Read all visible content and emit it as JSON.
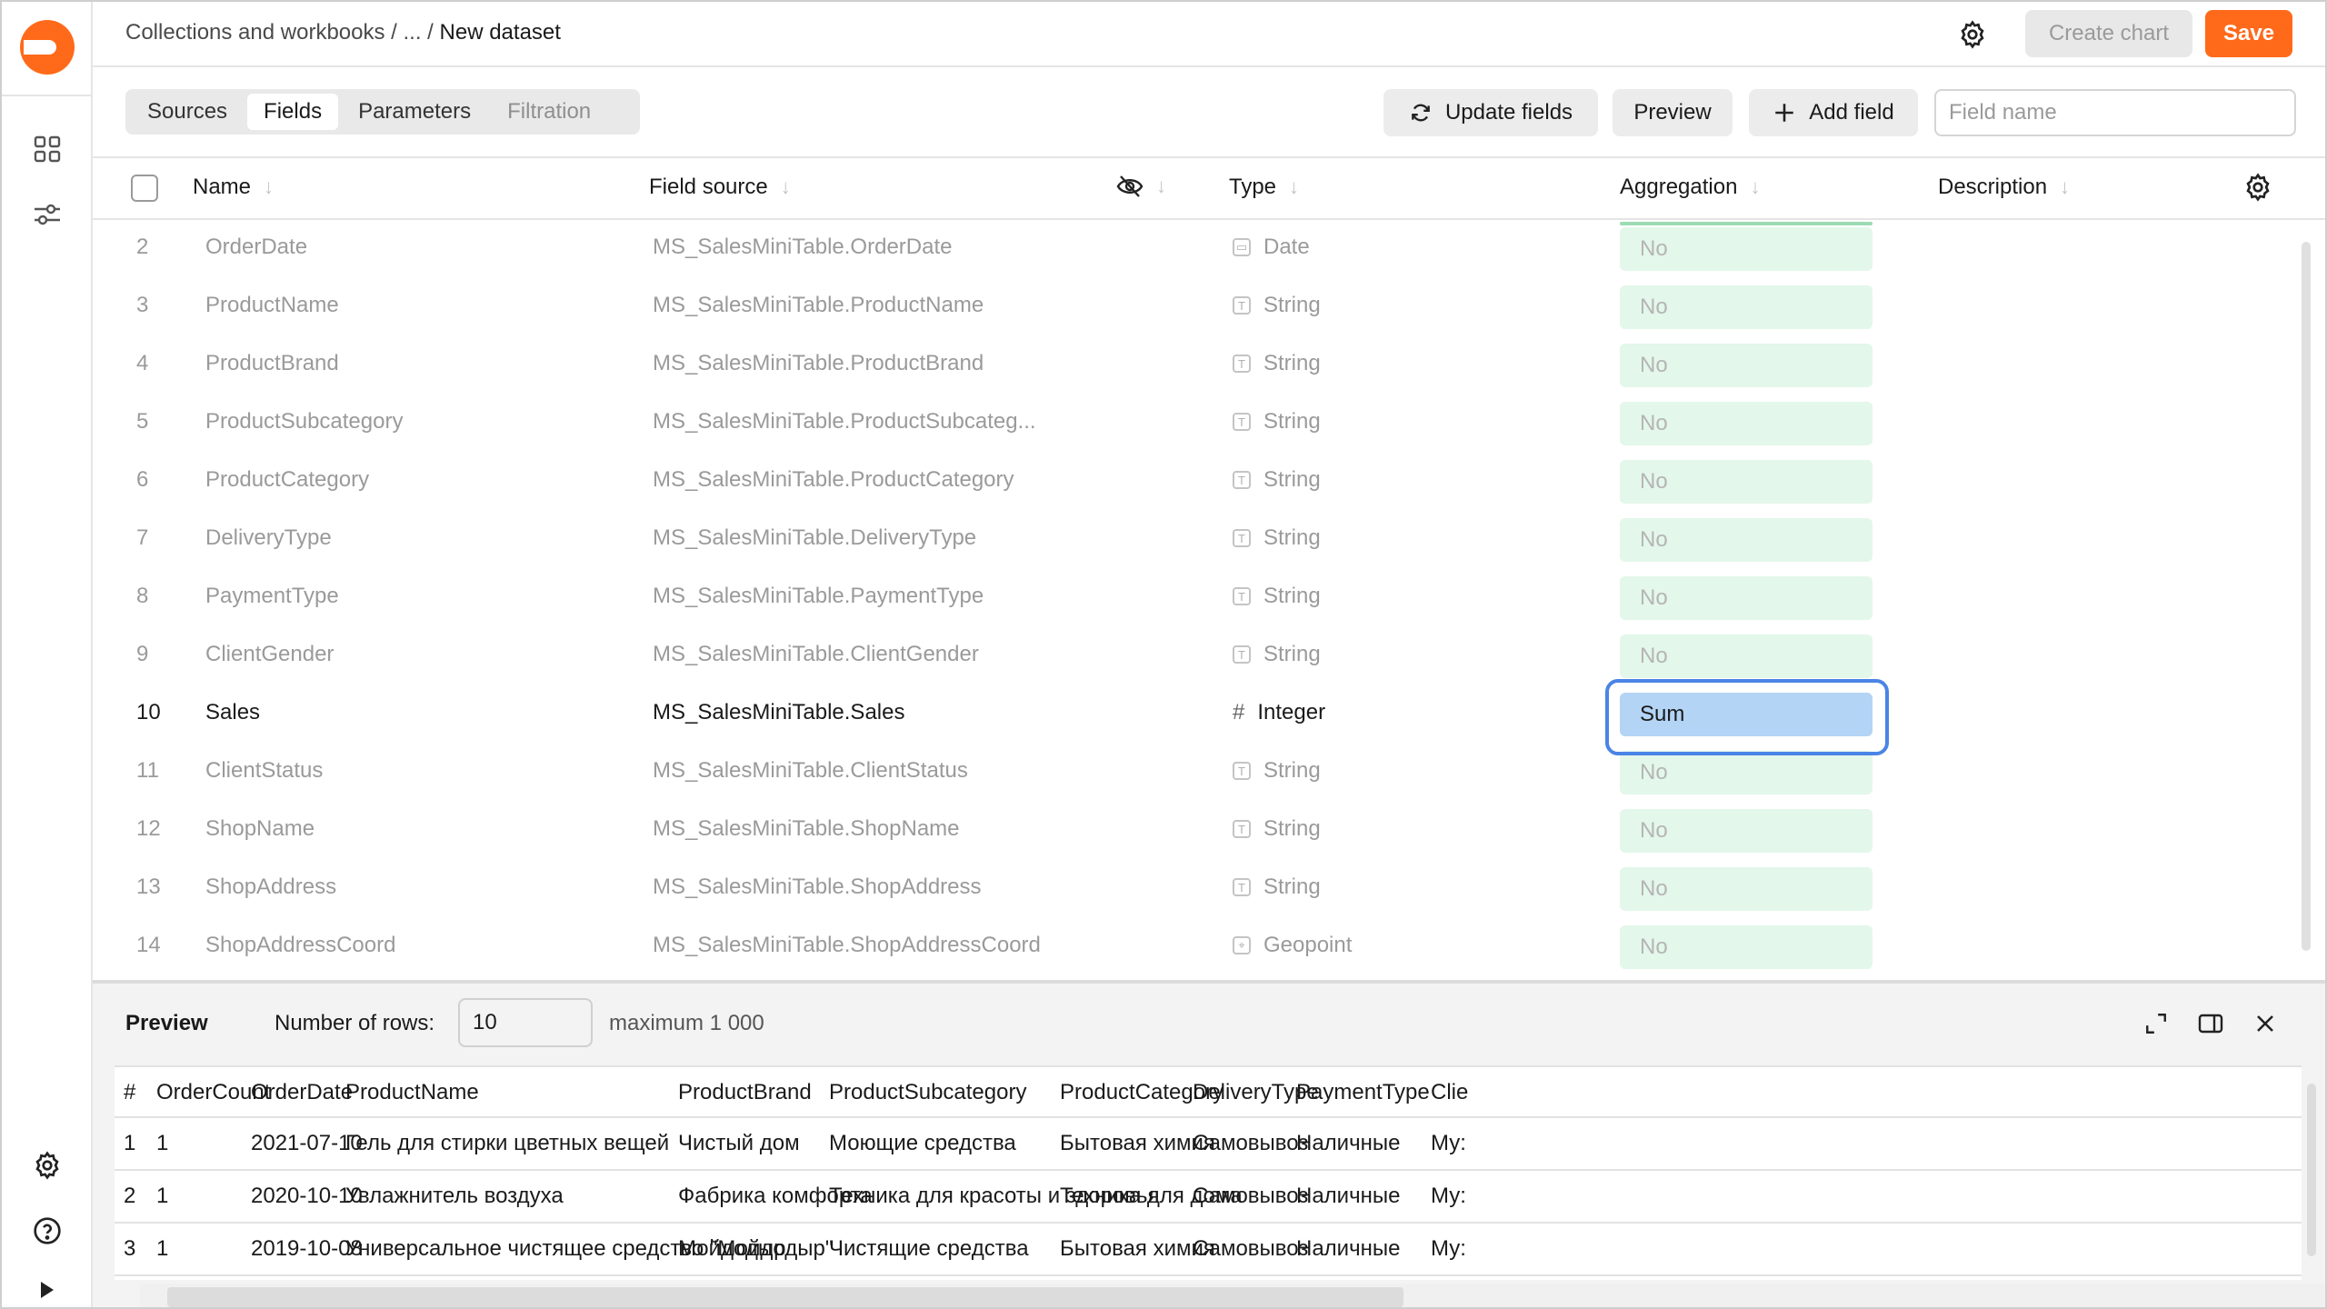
{
  "header": {
    "breadcrumb_root": "Collections and workbooks",
    "breadcrumb_sep1": " / ",
    "breadcrumb_ellipsis": "...",
    "breadcrumb_sep2": " / ",
    "breadcrumb_current": "New dataset",
    "create_chart_label": "Create chart",
    "save_label": "Save"
  },
  "colors": {
    "save": "#ff6a1a",
    "aggregation_default": "#e3f7ea",
    "aggregation_selected": "#b3d4f5",
    "focus_outline": "#4a84e6"
  },
  "toolbar": {
    "tabs": [
      {
        "label": "Sources",
        "state": "normal"
      },
      {
        "label": "Fields",
        "state": "active"
      },
      {
        "label": "Parameters",
        "state": "normal"
      },
      {
        "label": "Filtration",
        "state": "disabled"
      }
    ],
    "update_fields_label": "Update fields",
    "preview_label": "Preview",
    "add_field_label": "Add field",
    "search_placeholder": "Field name"
  },
  "fields_table": {
    "columns": {
      "name": "Name",
      "source": "Field source",
      "type": "Type",
      "aggregation": "Aggregation",
      "description": "Description"
    },
    "rows": [
      {
        "num": "2",
        "name": "OrderDate",
        "source": "MS_SalesMiniTable.OrderDate",
        "type": "Date",
        "type_icon": "calendar-icon",
        "aggregation": "No"
      },
      {
        "num": "3",
        "name": "ProductName",
        "source": "MS_SalesMiniTable.ProductName",
        "type": "String",
        "type_icon": "text-type-icon",
        "aggregation": "No"
      },
      {
        "num": "4",
        "name": "ProductBrand",
        "source": "MS_SalesMiniTable.ProductBrand",
        "type": "String",
        "type_icon": "text-type-icon",
        "aggregation": "No"
      },
      {
        "num": "5",
        "name": "ProductSubcategory",
        "source": "MS_SalesMiniTable.ProductSubcateg...",
        "type": "String",
        "type_icon": "text-type-icon",
        "aggregation": "No"
      },
      {
        "num": "6",
        "name": "ProductCategory",
        "source": "MS_SalesMiniTable.ProductCategory",
        "type": "String",
        "type_icon": "text-type-icon",
        "aggregation": "No"
      },
      {
        "num": "7",
        "name": "DeliveryType",
        "source": "MS_SalesMiniTable.DeliveryType",
        "type": "String",
        "type_icon": "text-type-icon",
        "aggregation": "No"
      },
      {
        "num": "8",
        "name": "PaymentType",
        "source": "MS_SalesMiniTable.PaymentType",
        "type": "String",
        "type_icon": "text-type-icon",
        "aggregation": "No"
      },
      {
        "num": "9",
        "name": "ClientGender",
        "source": "MS_SalesMiniTable.ClientGender",
        "type": "String",
        "type_icon": "text-type-icon",
        "aggregation": "No"
      },
      {
        "num": "10",
        "name": "Sales",
        "source": "MS_SalesMiniTable.Sales",
        "type": "Integer",
        "type_icon": "hash-icon",
        "aggregation": "Sum",
        "active": true
      },
      {
        "num": "11",
        "name": "ClientStatus",
        "source": "MS_SalesMiniTable.ClientStatus",
        "type": "String",
        "type_icon": "text-type-icon",
        "aggregation": "No"
      },
      {
        "num": "12",
        "name": "ShopName",
        "source": "MS_SalesMiniTable.ShopName",
        "type": "String",
        "type_icon": "text-type-icon",
        "aggregation": "No"
      },
      {
        "num": "13",
        "name": "ShopAddress",
        "source": "MS_SalesMiniTable.ShopAddress",
        "type": "String",
        "type_icon": "text-type-icon",
        "aggregation": "No"
      },
      {
        "num": "14",
        "name": "ShopAddressCoord",
        "source": "MS_SalesMiniTable.ShopAddressCoord",
        "type": "Geopoint",
        "type_icon": "geopoint-icon",
        "aggregation": "No"
      }
    ]
  },
  "preview": {
    "title": "Preview",
    "rows_label": "Number of rows:",
    "rows_value": "10",
    "rows_max": "maximum 1 000",
    "columns": [
      "#",
      "OrderCount",
      "OrderDate",
      "ProductName",
      "ProductBrand",
      "ProductSubcategory",
      "ProductCategory",
      "DeliveryType",
      "PaymentType",
      "Clie"
    ],
    "rows": [
      [
        "1",
        "1",
        "2021-07-10",
        "Гель для стирки цветных вещей",
        "Чистый дом",
        "Моющие средства",
        "Бытовая химия",
        "Самовывоз",
        "Наличные",
        "Му:"
      ],
      [
        "2",
        "1",
        "2020-10-10",
        "Увлажнитель воздуха",
        "Фабрика комфорта",
        "Техника для красоты и здоровья",
        "Техника для дома",
        "Самовывоз",
        "Наличные",
        "Му:"
      ],
      [
        "3",
        "1",
        "2019-10-08",
        "Универсальное чистящее средство \"Мойдодыр\"",
        "Мойдодыр",
        "Чистящие средства",
        "Бытовая химия",
        "Самовывоз",
        "Наличные",
        "Му:"
      ]
    ]
  }
}
